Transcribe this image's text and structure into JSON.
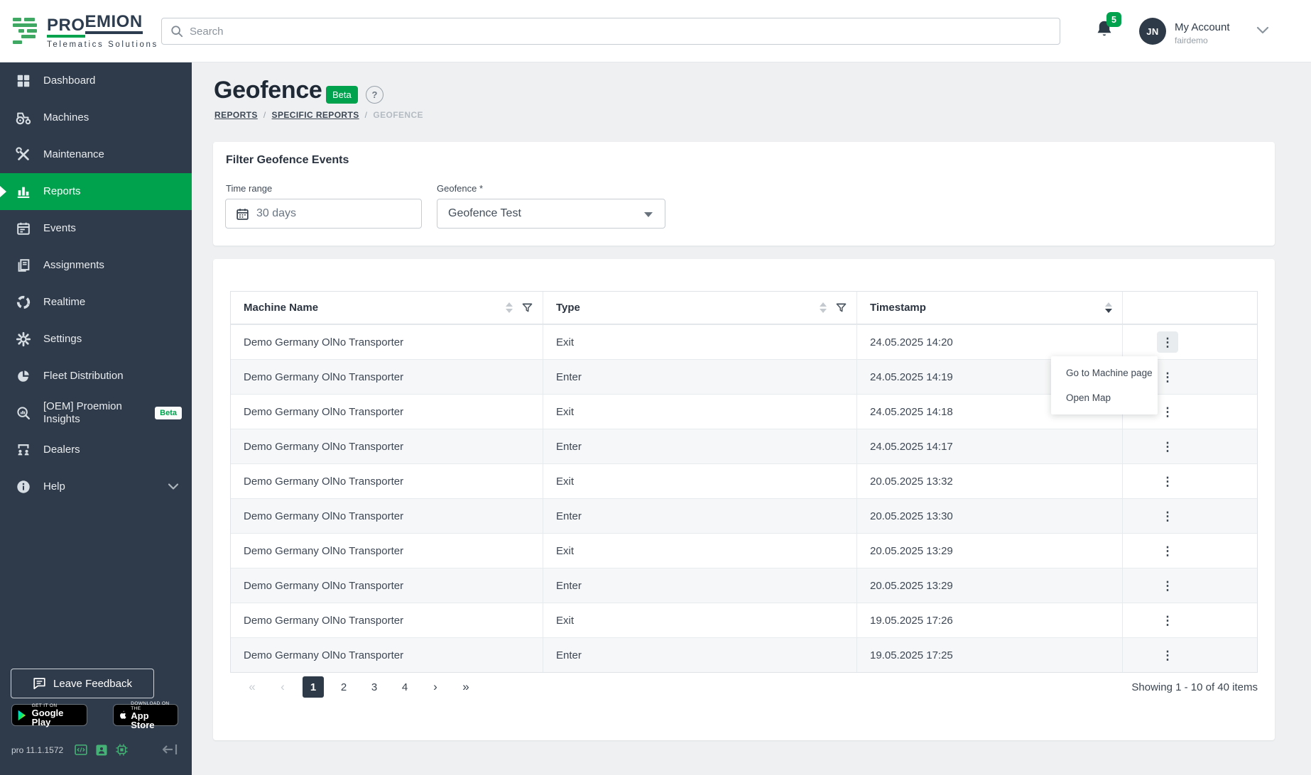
{
  "colors": {
    "accent": "#00a24d",
    "sidebar": "#2f3b4b",
    "green_logo": "#3fa963"
  },
  "header": {
    "logo": {
      "brand_pro": "PRO",
      "brand_emion": "EMION",
      "tagline": "Telematics Solutions"
    },
    "search": {
      "placeholder": "Search"
    },
    "notifications": {
      "count": "5"
    },
    "account": {
      "initials": "JN",
      "name": "My Account",
      "org": "fairdemo"
    }
  },
  "sidebar": {
    "items": [
      {
        "label": "Dashboard"
      },
      {
        "label": "Machines"
      },
      {
        "label": "Maintenance"
      },
      {
        "label": "Reports"
      },
      {
        "label": "Events"
      },
      {
        "label": "Assignments"
      },
      {
        "label": "Realtime"
      },
      {
        "label": "Settings"
      },
      {
        "label": "Fleet Distribution"
      },
      {
        "label": "[OEM] Proemion Insights",
        "badge": "Beta"
      },
      {
        "label": "Dealers"
      },
      {
        "label": "Help"
      }
    ],
    "feedback_label": "Leave Feedback",
    "store_badges": {
      "google_play": {
        "line1": "GET IT ON",
        "line2": "Google Play"
      },
      "app_store": {
        "line1": "Download on the",
        "line2": "App Store"
      }
    },
    "version": "pro 11.1.1572"
  },
  "page": {
    "title": "Geofence",
    "beta_badge": "Beta",
    "help_glyph": "?",
    "breadcrumb": {
      "items": [
        "REPORTS",
        "SPECIFIC REPORTS",
        "GEOFENCE"
      ],
      "sep": "/"
    }
  },
  "filter": {
    "title": "Filter Geofence Events",
    "time_range": {
      "label": "Time range",
      "value": "30 days"
    },
    "geofence": {
      "label": "Geofence *",
      "value": "Geofence Test"
    }
  },
  "table": {
    "columns": [
      {
        "label": "Machine Name"
      },
      {
        "label": "Type"
      },
      {
        "label": "Timestamp"
      }
    ],
    "rows": [
      {
        "machine": "Demo Germany OlNo Transporter",
        "type": "Exit",
        "timestamp": "24.05.2025 14:20"
      },
      {
        "machine": "Demo Germany OlNo Transporter",
        "type": "Enter",
        "timestamp": "24.05.2025 14:19"
      },
      {
        "machine": "Demo Germany OlNo Transporter",
        "type": "Exit",
        "timestamp": "24.05.2025 14:18"
      },
      {
        "machine": "Demo Germany OlNo Transporter",
        "type": "Enter",
        "timestamp": "24.05.2025 14:17"
      },
      {
        "machine": "Demo Germany OlNo Transporter",
        "type": "Exit",
        "timestamp": "20.05.2025 13:32"
      },
      {
        "machine": "Demo Germany OlNo Transporter",
        "type": "Enter",
        "timestamp": "20.05.2025 13:30"
      },
      {
        "machine": "Demo Germany OlNo Transporter",
        "type": "Exit",
        "timestamp": "20.05.2025 13:29"
      },
      {
        "machine": "Demo Germany OlNo Transporter",
        "type": "Enter",
        "timestamp": "20.05.2025 13:29"
      },
      {
        "machine": "Demo Germany OlNo Transporter",
        "type": "Exit",
        "timestamp": "19.05.2025 17:26"
      },
      {
        "machine": "Demo Germany OlNo Transporter",
        "type": "Enter",
        "timestamp": "19.05.2025 17:25"
      }
    ]
  },
  "row_menu": {
    "items": [
      "Go to Machine page",
      "Open Map"
    ]
  },
  "pagination": {
    "first": "«",
    "prev": "‹",
    "next": "›",
    "last": "»",
    "pages": [
      "1",
      "2",
      "3",
      "4"
    ],
    "active_page": "1",
    "summary": "Showing 1 - 10 of 40 items"
  },
  "glyphs": {
    "kebab": "⋮"
  }
}
